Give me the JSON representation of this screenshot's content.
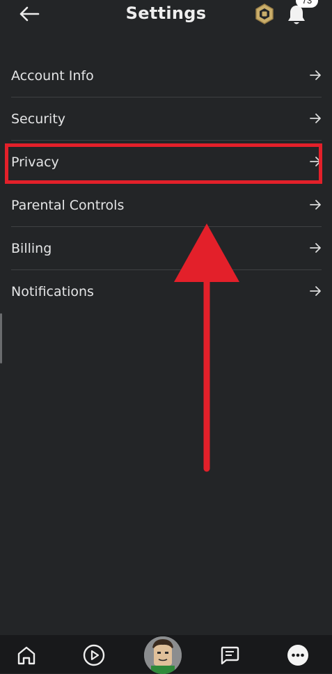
{
  "header": {
    "title": "Settings",
    "back_icon": "arrow-left-icon",
    "robux_icon": "robux-icon",
    "notification_icon": "bell-icon",
    "notification_count": "73"
  },
  "menu": {
    "items": [
      {
        "label": "Account Info"
      },
      {
        "label": "Security"
      },
      {
        "label": "Privacy"
      },
      {
        "label": "Parental Controls"
      },
      {
        "label": "Billing"
      },
      {
        "label": "Notifications"
      }
    ],
    "item_icon": "arrow-right-icon"
  },
  "annotation": {
    "highlight_color": "#e3202a",
    "arrow_color": "#e3202a"
  },
  "bottom_nav": {
    "items": [
      "home-icon",
      "play-icon",
      "avatar",
      "chat-icon",
      "more-icon"
    ]
  },
  "colors": {
    "background": "#232527",
    "nav_background": "#18191b",
    "divider": "#3f4143",
    "text": "#e4e5e6"
  }
}
